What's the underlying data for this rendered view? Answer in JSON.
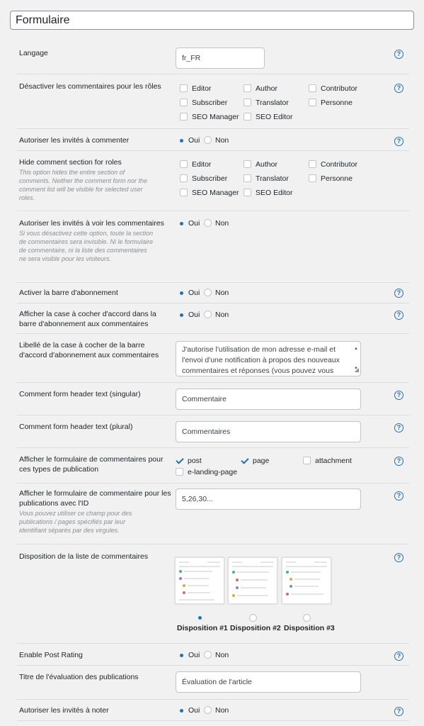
{
  "title": "Formulaire",
  "rows": {
    "language": {
      "label": "Langage",
      "value": "fr_FR"
    },
    "disable_comments": {
      "label": "Désactiver les commentaires pour les rôles",
      "roles": [
        "Editor",
        "Author",
        "Contributor",
        "Subscriber",
        "Translator",
        "Personne",
        "SEO Manager",
        "SEO Editor"
      ]
    },
    "guests_comment": {
      "label": "Autoriser les invités à commenter",
      "yes": "Oui",
      "no": "Non",
      "selected": "Oui"
    },
    "hide_section": {
      "label": "Hide comment section for roles",
      "desc": "This option hides the entire section of comments. Neither the comment form nor the comment list will be visible for selected user roles.",
      "roles": [
        "Editor",
        "Author",
        "Contributor",
        "Subscriber",
        "Translator",
        "Personne",
        "SEO Manager",
        "SEO Editor"
      ]
    },
    "guests_view": {
      "label": "Autoriser les invités à voir les commentaires",
      "desc": "Si vous désactivez cette option, toute la section de commentaires sera invisible. Ni le formulaire de commentaire, ni la liste des commentaires ne sera visible pour les visiteurs.",
      "yes": "Oui",
      "no": "Non",
      "selected": "Oui"
    },
    "subscription_bar": {
      "label": "Activer la barre d'abonnement",
      "yes": "Oui",
      "no": "Non",
      "selected": "Oui"
    },
    "consent_checkbox": {
      "label": "Afficher la case à cocher d'accord dans la barre d'abonnement aux commentaires",
      "yes": "Oui",
      "no": "Non",
      "selected": "Oui"
    },
    "consent_label": {
      "label": "Libellé de la case à cocher de la barre d'accord d'abonnement aux commentaires",
      "value": "J'autorise l'utilisation de mon adresse e-mail et l'envoi d'une notification à propos des nouveaux commentaires et réponses (vous pouvez vous"
    },
    "header_singular": {
      "label": "Comment form header text (singular)",
      "value": "Commentaire"
    },
    "header_plural": {
      "label": "Comment form header text (plural)",
      "value": "Commentaires"
    },
    "post_types": {
      "label": "Afficher le formulaire de commentaires pour ces types de publication",
      "types": [
        "post",
        "page",
        "attachment",
        "e-landing-page"
      ]
    },
    "post_ids": {
      "label": "Afficher le formulaire de commentaire pour les publications avec l'ID",
      "desc": "Vous pouvez utiliser ce champ pour des publications / pages spécifiés par leur identifiant séparés par des virgules.",
      "value": "5,26,30..."
    },
    "layout": {
      "label": "Disposition de la liste de commentaires",
      "options": [
        "Disposition #1",
        "Disposition #2",
        "Disposition #3"
      ],
      "selected": "Disposition #1"
    },
    "post_rating": {
      "label": "Enable Post Rating",
      "yes": "Oui",
      "no": "Non",
      "selected": "Oui"
    },
    "rating_title": {
      "label": "Titre de l'évaluation des publications",
      "value": "Évaluation de l'article"
    },
    "guests_rate": {
      "label": "Autoriser les invités à noter",
      "yes": "Oui",
      "no": "Non",
      "selected": "Oui"
    }
  },
  "help_icon": "question-circle-icon",
  "colors": {
    "accent": "#2271b1",
    "border": "#c3c4c7",
    "background": "#f1f1f1"
  }
}
